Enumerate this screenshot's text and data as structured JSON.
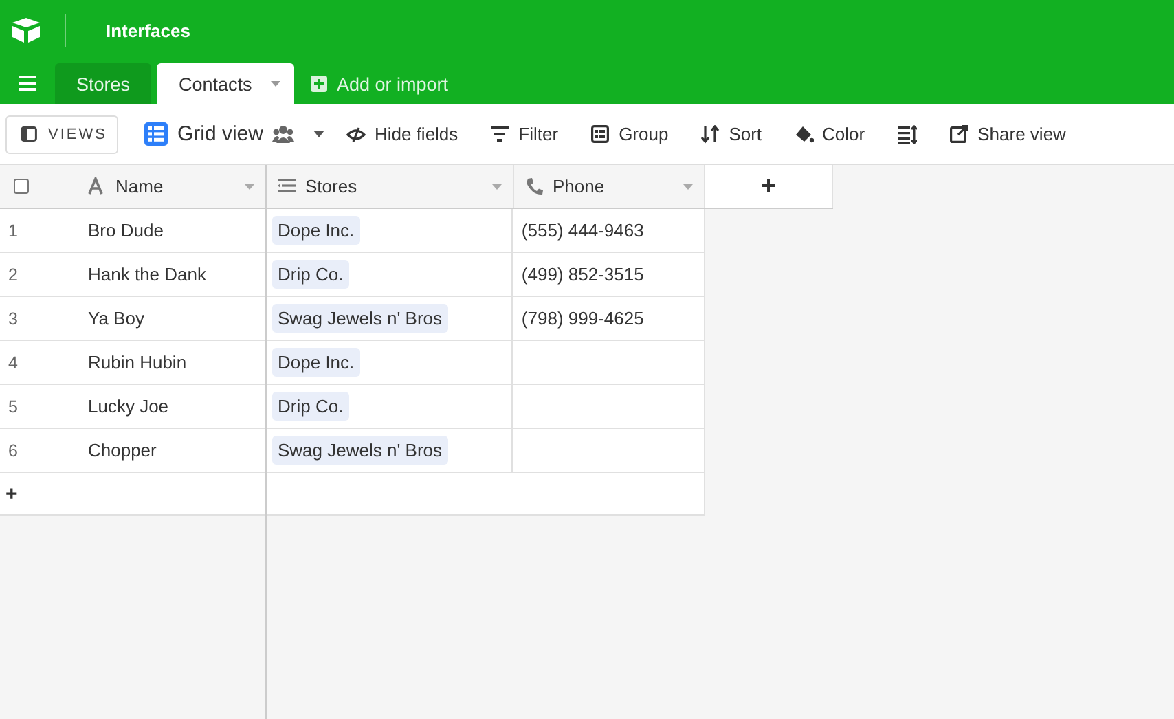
{
  "header": {
    "title": "Interfaces"
  },
  "tabs": [
    {
      "label": "Stores",
      "selected": false
    },
    {
      "label": "Contacts",
      "selected": true
    }
  ],
  "add_table": {
    "label": "Add or import"
  },
  "toolbar": {
    "views_button": "VIEWS",
    "view_name": "Grid view",
    "actions": [
      {
        "kind": "labeled",
        "label": "Hide fields"
      },
      {
        "kind": "labeled",
        "label": "Filter"
      },
      {
        "kind": "labeled",
        "label": "Group"
      },
      {
        "kind": "labeled",
        "label": "Sort"
      },
      {
        "kind": "labeled",
        "label": "Color"
      },
      {
        "kind": "icon_only"
      },
      {
        "kind": "labeled",
        "label": "Share view"
      }
    ]
  },
  "select_all": {
    "checked": false
  },
  "table": {
    "columns": [
      {
        "name": "Name"
      },
      {
        "name": "Stores"
      },
      {
        "name": "Phone"
      }
    ],
    "add_column": "+",
    "rows": [
      {
        "number": "1",
        "name": "Bro Dude",
        "store": "Dope Inc.",
        "phone": "(555) 444-9463"
      },
      {
        "number": "2",
        "name": "Hank the Dank",
        "store": "Drip Co.",
        "phone": "(499) 852-3515"
      },
      {
        "number": "3",
        "name": "Ya Boy",
        "store": "Swag Jewels n' Bros",
        "phone": "(798) 999-4625"
      },
      {
        "number": "4",
        "name": "Rubin Hubin",
        "store": "Dope Inc."
      },
      {
        "number": "5",
        "name": "Lucky Joe",
        "store": "Drip Co."
      },
      {
        "number": "6",
        "name": "Chopper",
        "store": "Swag Jewels n' Bros"
      }
    ],
    "add_row": "+"
  }
}
